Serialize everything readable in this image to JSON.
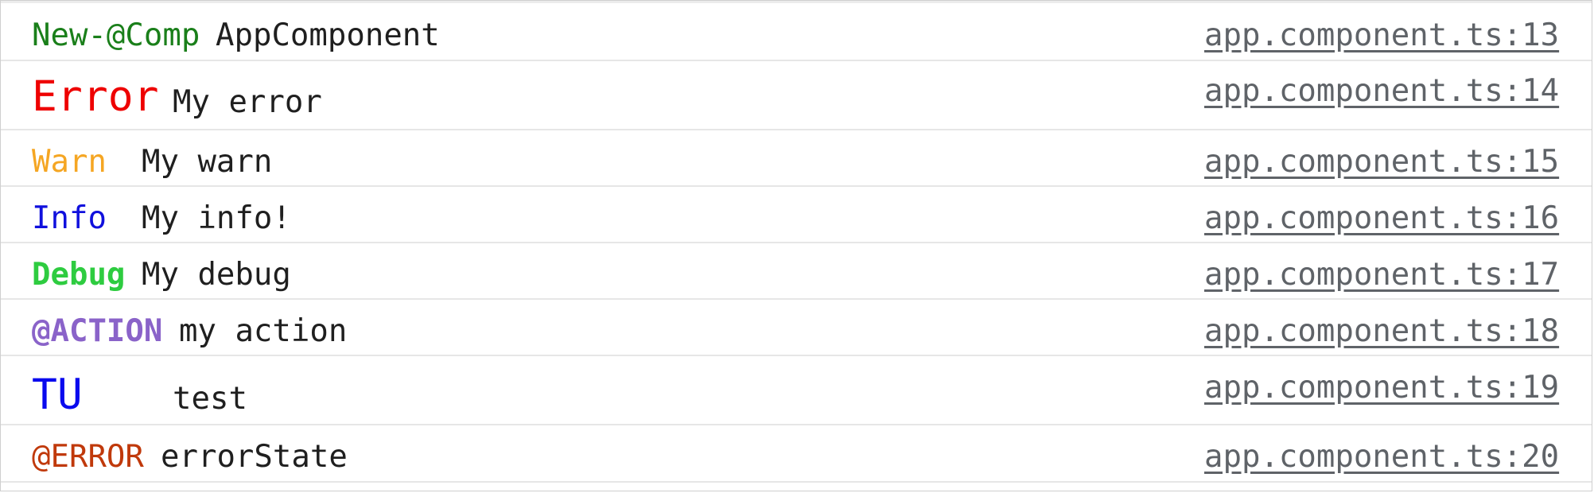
{
  "console": {
    "entries": [
      {
        "label": "New-@Comp",
        "label_color": "#1a7f1a",
        "message": "AppComponent",
        "source": "app.component.ts:13"
      },
      {
        "label": "Error",
        "label_color": "#ee0000",
        "message": "My error",
        "source": "app.component.ts:14"
      },
      {
        "label": "Warn",
        "label_color": "#f5a623",
        "message": "My warn",
        "source": "app.component.ts:15"
      },
      {
        "label": "Info",
        "label_color": "#1010dd",
        "message": "My info!",
        "source": "app.component.ts:16"
      },
      {
        "label": "Debug",
        "label_color": "#2ecc40",
        "message": "My debug",
        "source": "app.component.ts:17"
      },
      {
        "label": "@ACTION",
        "label_color": "#8a63c9",
        "message": "my action",
        "source": "app.component.ts:18"
      },
      {
        "label": "TU",
        "label_color": "#0a0aee",
        "message": "test",
        "source": "app.component.ts:19"
      },
      {
        "label": "@ERROR",
        "label_color": "#c0390b",
        "message": "errorState",
        "source": "app.component.ts:20"
      }
    ]
  }
}
